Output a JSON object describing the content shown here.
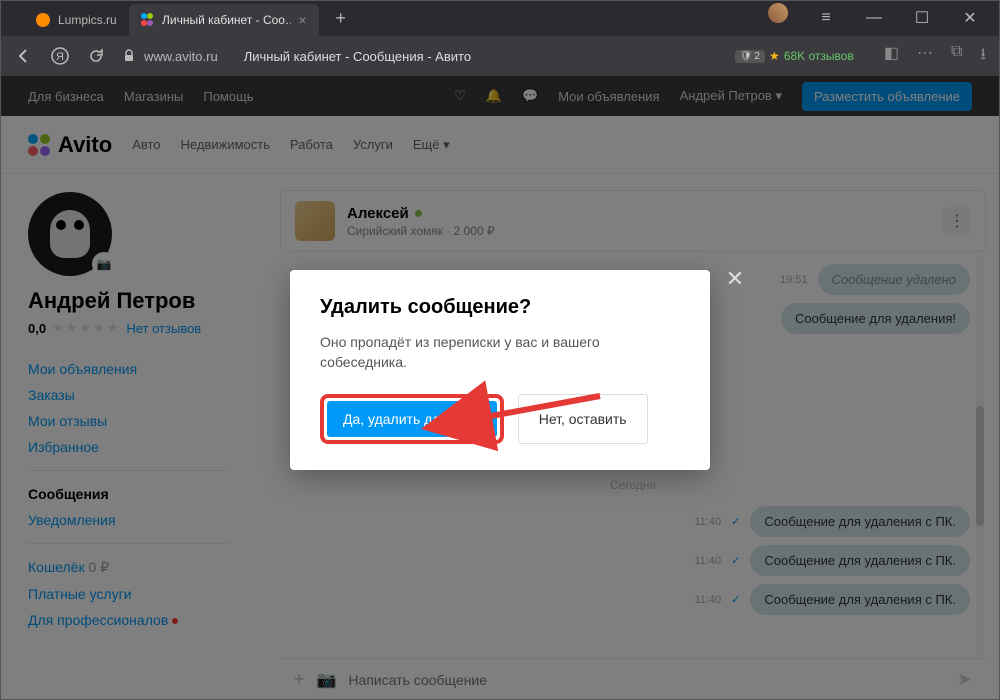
{
  "browser": {
    "tabs": [
      {
        "label": "Lumpics.ru"
      },
      {
        "label": "Личный кабинет - Соо…"
      }
    ],
    "url_host": "www.avito.ru",
    "page_title": "Личный кабинет - Сообщения - Авито",
    "ext_badge": "2",
    "rating_ext": "68K отзывов"
  },
  "topnav": {
    "business": "Для бизнеса",
    "shops": "Магазины",
    "help": "Помощь",
    "myads": "Мои объявления",
    "user": "Андрей Петров",
    "post": "Разместить объявление"
  },
  "header": {
    "brand": "Avito",
    "cats": [
      "Авто",
      "Недвижимость",
      "Работа",
      "Услуги",
      "Ещё"
    ]
  },
  "sidebar": {
    "name": "Андрей Петров",
    "rating": "0,0",
    "noreviews": "Нет отзывов",
    "menu": {
      "myads": "Мои объявления",
      "orders": "Заказы",
      "reviews": "Мои отзывы",
      "fav": "Избранное",
      "messages": "Сообщения",
      "notif": "Уведомления",
      "wallet": "Кошелёк",
      "wallet_amt": "0 ₽",
      "paid": "Платные услуги",
      "pro": "Для профессионалов"
    }
  },
  "chat": {
    "peer": "Алексей",
    "subject": "Сирийский хомяк · 2 000 ₽",
    "msg_deleted": "Сообщение удалено",
    "msg_todelete": "Сообщение для удаления!",
    "time1": "19:51",
    "date_sep": "Сегодня",
    "rows": [
      {
        "time": "11:40",
        "text": "Сообщение для удаления с ПК."
      },
      {
        "time": "11:40",
        "text": "Сообщение для удаления с ПК."
      },
      {
        "time": "11:40",
        "text": "Сообщение для удаления с ПК."
      }
    ],
    "placeholder": "Написать сообщение"
  },
  "modal": {
    "title": "Удалить сообщение?",
    "body": "Оно пропадёт из переписки у вас и вашего собеседника.",
    "yes": "Да, удалить для всех",
    "no": "Нет, оставить"
  }
}
